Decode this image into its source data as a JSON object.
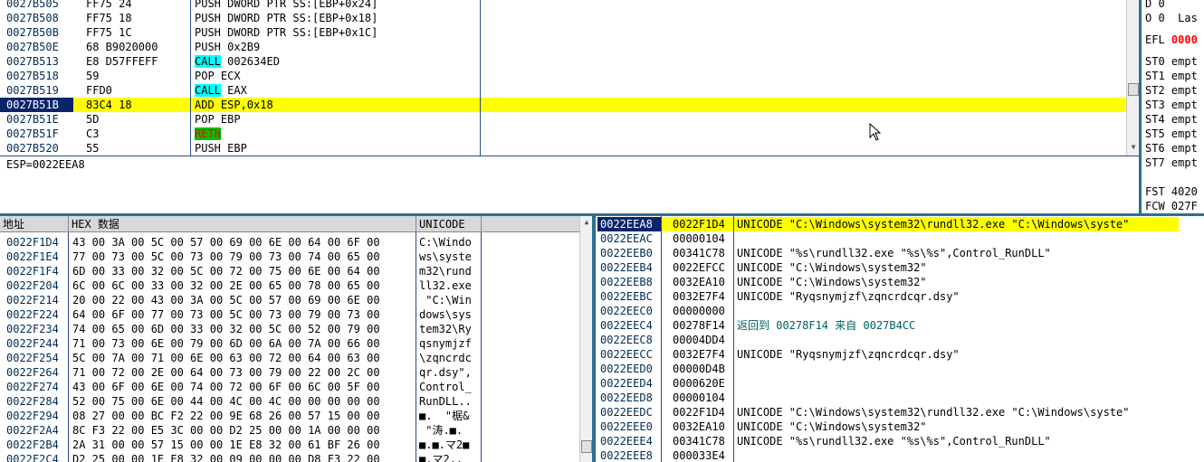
{
  "cpu": {
    "rows": [
      {
        "addr": "0027B505",
        "hex": "FF75 24",
        "asm": "PUSH DWORD PTR SS:[EBP+0x24]",
        "kw": "",
        "rest": ""
      },
      {
        "addr": "0027B508",
        "hex": "FF75 18",
        "asm": "PUSH DWORD PTR SS:[EBP+0x18]",
        "kw": "",
        "rest": ""
      },
      {
        "addr": "0027B50B",
        "hex": "FF75 1C",
        "asm": "PUSH DWORD PTR SS:[EBP+0x1C]",
        "kw": "",
        "rest": ""
      },
      {
        "addr": "0027B50E",
        "hex": "68 B9020000",
        "asm": "PUSH 0x2B9",
        "kw": "",
        "rest": ""
      },
      {
        "addr": "0027B513",
        "hex": "E8 D57FFEFF",
        "asm": "",
        "kw": "CALL",
        "rest": " 002634ED"
      },
      {
        "addr": "0027B518",
        "hex": "59",
        "asm": "POP ECX",
        "kw": "",
        "rest": ""
      },
      {
        "addr": "0027B519",
        "hex": "FFD0",
        "asm": "",
        "kw": "CALL",
        "rest": " EAX"
      },
      {
        "addr": "0027B51B",
        "hex": "83C4 18",
        "asm": "ADD ESP,0x18",
        "kw": "",
        "rest": ""
      },
      {
        "addr": "0027B51E",
        "hex": "5D",
        "asm": "POP EBP",
        "kw": "",
        "rest": ""
      },
      {
        "addr": "0027B51F",
        "hex": "C3",
        "asm": "",
        "kw": "RETN",
        "rest": ""
      },
      {
        "addr": "0027B520",
        "hex": "55",
        "asm": "PUSH EBP",
        "kw": "",
        "rest": ""
      }
    ],
    "info": "ESP=0022EEA8"
  },
  "registers": {
    "lines": [
      "D 0",
      "O 0  Las",
      "",
      "EFL 0000",
      "",
      "ST0 empt",
      "ST1 empt",
      "ST2 empt",
      "ST3 empt",
      "ST4 empt",
      "ST5 empt",
      "ST6 empt",
      "ST7 empt",
      "",
      "FST 4020",
      "FCW 027F"
    ],
    "efl_value_color": "#ff0000"
  },
  "dump": {
    "headers": {
      "addr": "地址",
      "hex": "HEX 数据",
      "unicode": "UNICODE"
    },
    "rows": [
      {
        "addr": "0022F1D4",
        "hex": "43 00 3A 00 5C 00 57 00 69 00 6E 00 64 00 6F 00",
        "text": "C:\\Windo"
      },
      {
        "addr": "0022F1E4",
        "hex": "77 00 73 00 5C 00 73 00 79 00 73 00 74 00 65 00",
        "text": "ws\\syste"
      },
      {
        "addr": "0022F1F4",
        "hex": "6D 00 33 00 32 00 5C 00 72 00 75 00 6E 00 64 00",
        "text": "m32\\rund"
      },
      {
        "addr": "0022F204",
        "hex": "6C 00 6C 00 33 00 32 00 2E 00 65 00 78 00 65 00",
        "text": "ll32.exe"
      },
      {
        "addr": "0022F214",
        "hex": "20 00 22 00 43 00 3A 00 5C 00 57 00 69 00 6E 00",
        "text": " \"C:\\Win"
      },
      {
        "addr": "0022F224",
        "hex": "64 00 6F 00 77 00 73 00 5C 00 73 00 79 00 73 00",
        "text": "dows\\sys"
      },
      {
        "addr": "0022F234",
        "hex": "74 00 65 00 6D 00 33 00 32 00 5C 00 52 00 79 00",
        "text": "tem32\\Ry"
      },
      {
        "addr": "0022F244",
        "hex": "71 00 73 00 6E 00 79 00 6D 00 6A 00 7A 00 66 00",
        "text": "qsnymjzf"
      },
      {
        "addr": "0022F254",
        "hex": "5C 00 7A 00 71 00 6E 00 63 00 72 00 64 00 63 00",
        "text": "\\zqncrdc"
      },
      {
        "addr": "0022F264",
        "hex": "71 00 72 00 2E 00 64 00 73 00 79 00 22 00 2C 00",
        "text": "qr.dsy\","
      },
      {
        "addr": "0022F274",
        "hex": "43 00 6F 00 6E 00 74 00 72 00 6F 00 6C 00 5F 00",
        "text": "Control_"
      },
      {
        "addr": "0022F284",
        "hex": "52 00 75 00 6E 00 44 00 4C 00 4C 00 00 00 00 00",
        "text": "RunDLL.."
      },
      {
        "addr": "0022F294",
        "hex": "08 27 00 00 BC F2 22 00 9E 68 26 00 57 15 00 00",
        "text": "■.  \"椐&"
      },
      {
        "addr": "0022F2A4",
        "hex": "8C F3 22 00 E5 3C 00 00 D2 25 00 00 1A 00 00 00",
        "text": " \"涛.■."
      },
      {
        "addr": "0022F2B4",
        "hex": "2A 31 00 00 57 15 00 00 1E E8 32 00 61 BF 26 00",
        "text": "■.■.マ2■"
      },
      {
        "addr": "0022F2C4",
        "hex": "D2 25 00 00 1E E8 32 00 09 00 00 00 D8 F3 22 00",
        "text": "■.マ2.."
      }
    ]
  },
  "stack": {
    "rows": [
      {
        "addr": "0022EEA8",
        "val": "0022F1D4",
        "cmt": "UNICODE \"C:\\Windows\\system32\\rundll32.exe \"C:\\Windows\\syste\""
      },
      {
        "addr": "0022EEAC",
        "val": "00000104",
        "cmt": ""
      },
      {
        "addr": "0022EEB0",
        "val": "00341C78",
        "cmt": "UNICODE \"%s\\rundll32.exe \"%s\\%s\",Control_RunDLL\""
      },
      {
        "addr": "0022EEB4",
        "val": "0022EFCC",
        "cmt": "UNICODE \"C:\\Windows\\system32\""
      },
      {
        "addr": "0022EEB8",
        "val": "0032EA10",
        "cmt": "UNICODE \"C:\\Windows\\system32\""
      },
      {
        "addr": "0022EEBC",
        "val": "0032E7F4",
        "cmt": "UNICODE \"Ryqsnymjzf\\zqncrdcqr.dsy\""
      },
      {
        "addr": "0022EEC0",
        "val": "00000000",
        "cmt": ""
      },
      {
        "addr": "0022EEC4",
        "val": "00278F14",
        "cmt": "返回到 00278F14 来自 0027B4CC"
      },
      {
        "addr": "0022EEC8",
        "val": "00004DD4",
        "cmt": ""
      },
      {
        "addr": "0022EECC",
        "val": "0032E7F4",
        "cmt": "UNICODE \"Ryqsnymjzf\\zqncrdcqr.dsy\""
      },
      {
        "addr": "0022EED0",
        "val": "00000D4B",
        "cmt": ""
      },
      {
        "addr": "0022EED4",
        "val": "0000620E",
        "cmt": ""
      },
      {
        "addr": "0022EED8",
        "val": "00000104",
        "cmt": ""
      },
      {
        "addr": "0022EEDC",
        "val": "0022F1D4",
        "cmt": "UNICODE \"C:\\Windows\\system32\\rundll32.exe \"C:\\Windows\\syste\""
      },
      {
        "addr": "0022EEE0",
        "val": "0032EA10",
        "cmt": "UNICODE \"C:\\Windows\\system32\""
      },
      {
        "addr": "0022EEE4",
        "val": "00341C78",
        "cmt": "UNICODE \"%s\\rundll32.exe \"%s\\%s\",Control_RunDLL\""
      },
      {
        "addr": "0022EEE8",
        "val": "000033E4",
        "cmt": ""
      }
    ]
  },
  "colors": {
    "selection": "#ffff00",
    "selected_addr": "#0a246a",
    "call_hl": "#00ffff",
    "retn_hl": "#00c000",
    "separator": "#2f6e8e"
  }
}
